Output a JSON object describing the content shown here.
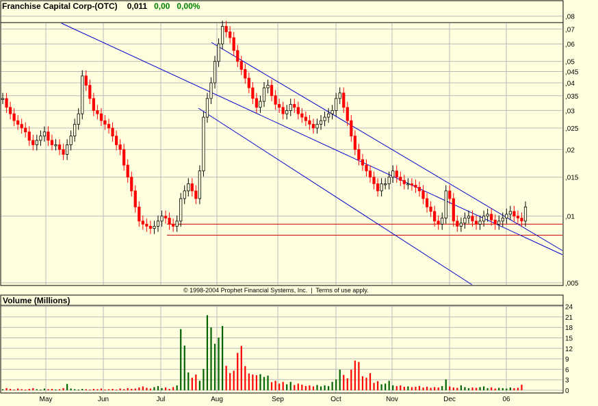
{
  "header": {
    "name": "Franchise Capital Corp-(OTC)",
    "last": "0,011",
    "change": "0,00",
    "change_pct": "0,00%"
  },
  "copyright": "© 1998-2004 Prophet Financial Systems, Inc.  |  Terms of use apply.",
  "volume_title": "Volume (Millions)",
  "colors": {
    "up": "#000000",
    "up_fill": "#ffffe0",
    "down": "#ff0000",
    "trend": "#0000cc",
    "support": "#cc0000",
    "grid": "#b8b8b8",
    "vol_up": "#006400",
    "vol_down": "#ff0000"
  },
  "chart_data": [
    {
      "type": "candlestick",
      "scale": "log",
      "ylim": [
        0.005,
        0.1
      ],
      "y_ticks": [
        ",08",
        ",07",
        ",06",
        ",05",
        ",045",
        ",04",
        ",035",
        ",03",
        ",025",
        ",02",
        ",015",
        ",01",
        ",005"
      ],
      "x_ticks": [
        "May",
        "Jun",
        "Jul",
        "Aug",
        "Sep",
        "Oct",
        "Nov",
        "Dec",
        "06"
      ],
      "support_levels": [
        0.0092,
        0.0082
      ],
      "series": [
        {
          "values": [
            0.034,
            0.031,
            0.029,
            0.027,
            0.026,
            0.025,
            0.024,
            0.022,
            0.021,
            0.022,
            0.023,
            0.024,
            0.022,
            0.021,
            0.021,
            0.02,
            0.019,
            0.021,
            0.023,
            0.026,
            0.029,
            0.043,
            0.039,
            0.034,
            0.03,
            0.029,
            0.027,
            0.026,
            0.025,
            0.023,
            0.021,
            0.02,
            0.017,
            0.015,
            0.013,
            0.011,
            0.0095,
            0.0092,
            0.009,
            0.0088,
            0.009,
            0.0095,
            0.01,
            0.0098,
            0.0092,
            0.009,
            0.0095,
            0.012,
            0.013,
            0.014,
            0.013,
            0.012,
            0.016,
            0.028,
            0.034,
            0.04,
            0.05,
            0.06,
            0.072,
            0.068,
            0.064,
            0.056,
            0.05,
            0.046,
            0.042,
            0.038,
            0.034,
            0.031,
            0.033,
            0.038,
            0.039,
            0.035,
            0.032,
            0.031,
            0.029,
            0.03,
            0.032,
            0.031,
            0.029,
            0.028,
            0.027,
            0.026,
            0.025,
            0.026,
            0.027,
            0.028,
            0.029,
            0.03,
            0.034,
            0.036,
            0.031,
            0.027,
            0.023,
            0.02,
            0.018,
            0.017,
            0.016,
            0.015,
            0.014,
            0.013,
            0.014,
            0.014,
            0.015,
            0.016,
            0.015,
            0.0145,
            0.014,
            0.014,
            0.0138,
            0.0135,
            0.013,
            0.012,
            0.011,
            0.0105,
            0.0095,
            0.0092,
            0.0098,
            0.013,
            0.012,
            0.0095,
            0.009,
            0.0093,
            0.0098,
            0.01,
            0.0095,
            0.0092,
            0.0095,
            0.01,
            0.0102,
            0.0096,
            0.0092,
            0.0095,
            0.0098,
            0.0102,
            0.0105,
            0.01,
            0.0098,
            0.0095,
            0.011
          ]
        }
      ]
    },
    {
      "type": "bar",
      "title": "Volume (Millions)",
      "ylim": [
        0,
        24
      ],
      "y_ticks": [
        24,
        21,
        18,
        15,
        12,
        9,
        6,
        3,
        0
      ],
      "series": [
        {
          "values": [
            0.3,
            0.6,
            0.4,
            0.2,
            0.5,
            0.3,
            0.2,
            0.4,
            0.6,
            0.3,
            0.2,
            0.5,
            0.3,
            0.4,
            0.2,
            0.3,
            0.6,
            1.8,
            0.5,
            0.3,
            0.2,
            0.4,
            0.3,
            0.2,
            0.4,
            0.3,
            0.5,
            0.2,
            0.3,
            0.4,
            0.2,
            0.5,
            0.3,
            0.6,
            0.4,
            0.5,
            0.8,
            1.1,
            0.7,
            0.5,
            0.9,
            1.2,
            0.6,
            0.8,
            0.4,
            0.9,
            1.4,
            17.5,
            12.8,
            5.1,
            3.6,
            4.5,
            2.7,
            6.1,
            21.5,
            18.0,
            13.3,
            15.1,
            18.4,
            7.0,
            4.9,
            5.6,
            10.7,
            12.7,
            6.9,
            4.8,
            4.5,
            4.3,
            4.6,
            3.8,
            4.2,
            2.3,
            2.7,
            1.9,
            2.4,
            1.7,
            2.4,
            1.5,
            1.9,
            1.6,
            1.2,
            1.4,
            1.1,
            1.5,
            1.1,
            1.4,
            1.2,
            2.4,
            3.1,
            5.9,
            4.4,
            3.4,
            5.9,
            8.5,
            8.1,
            4.0,
            3.6,
            4.9,
            2.1,
            2.6,
            1.7,
            1.9,
            2.7,
            1.4,
            1.2,
            1.4,
            1.0,
            1.1,
            0.9,
            1.0,
            1.2,
            0.8,
            1.0,
            0.7,
            0.9,
            0.8,
            1.2,
            3.1,
            1.1,
            0.8,
            0.7,
            1.4,
            0.9,
            0.6,
            0.8,
            0.7,
            0.9,
            1.1,
            0.6,
            0.8,
            0.5,
            0.7,
            0.6,
            0.5,
            0.8,
            0.6,
            0.7,
            1.6
          ]
        }
      ]
    }
  ]
}
